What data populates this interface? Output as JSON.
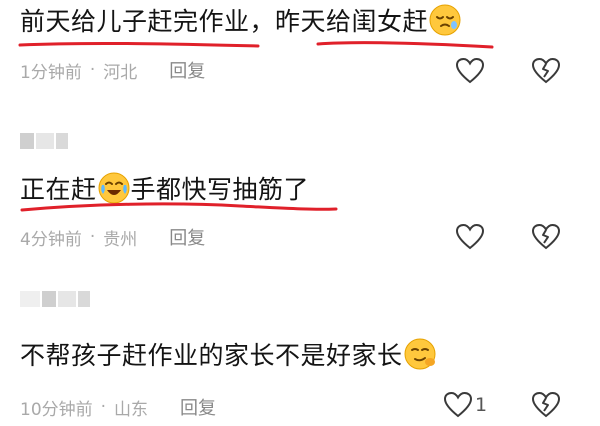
{
  "comments": [
    {
      "text_a": "前天给儿子赶完作业，昨天给闺女赶",
      "time": "1分钟前",
      "location": "河北",
      "reply_label": "回复",
      "like_count": ""
    },
    {
      "text_a": "正在赶",
      "text_b": "手都快写抽筋了",
      "time": "4分钟前",
      "location": "贵州",
      "reply_label": "回复",
      "like_count": ""
    },
    {
      "text_a": "不帮孩子赶作业的家长不是好家长",
      "time": "10分钟前",
      "location": "山东",
      "reply_label": "回复",
      "like_count": "1"
    }
  ],
  "separator": "·",
  "colors": {
    "underline": "#e0202a",
    "meta": "#a9a9a9",
    "icon": "#3a3a3a"
  },
  "icons": [
    "heart-outline-icon",
    "broken-heart-icon",
    "sleepy-emoji-icon",
    "crying-laughing-emoji-icon",
    "smirk-emoji-icon"
  ]
}
